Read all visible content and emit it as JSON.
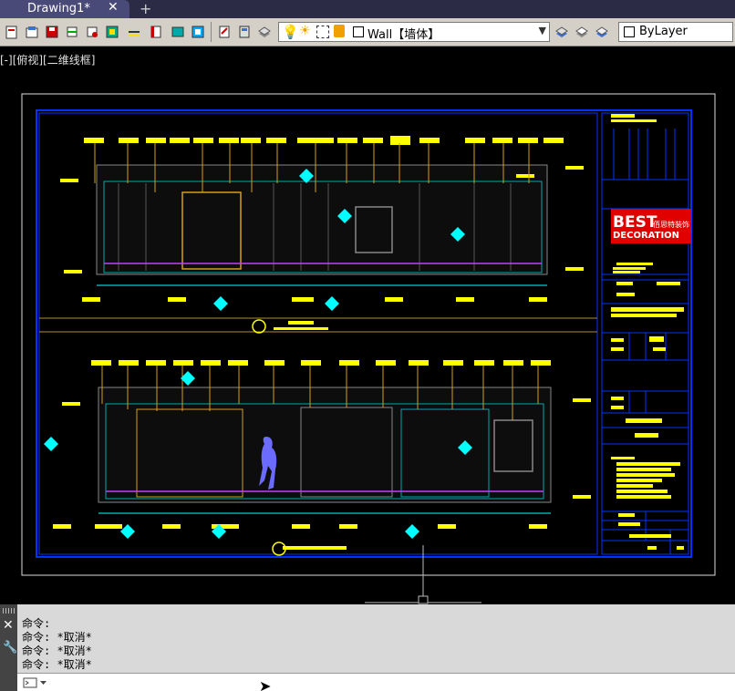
{
  "tabs": [
    {
      "label": "Drawing1*",
      "close": "✕"
    }
  ],
  "new_tab": "+",
  "toolbar": {
    "icons": [
      "new-icon",
      "open-icon",
      "save-icon",
      "plot-icon",
      "print-preview-icon",
      "layer-icon",
      "line-icon",
      "block-icon",
      "match-icon",
      "properties-icon",
      "design-center-icon",
      "calculator-icon",
      "layer-state-icon"
    ],
    "layer_combo": {
      "value": "Wall【墙体】"
    },
    "color_combo": {
      "value": "ByLayer"
    },
    "colors": {
      "toolbar_bg": "#d4d0c8",
      "tab_active": "#4a4a78"
    }
  },
  "viewport": {
    "label": "[-][俯视][二维线框]",
    "colors": {
      "frame": "#0033ff",
      "annotation": "#ffff00",
      "dim": "#00ffff",
      "line": "#d4a017",
      "figure": "#6b6bff"
    }
  },
  "title_block": {
    "logo_main": "BEST",
    "logo_sub": "DECORATION",
    "logo_cn": "佰思特装饰"
  },
  "command": {
    "history": [
      "命令:",
      "命令: *取消*",
      "命令: *取消*",
      "命令: *取消*"
    ],
    "input_value": "",
    "input_placeholder": ""
  }
}
